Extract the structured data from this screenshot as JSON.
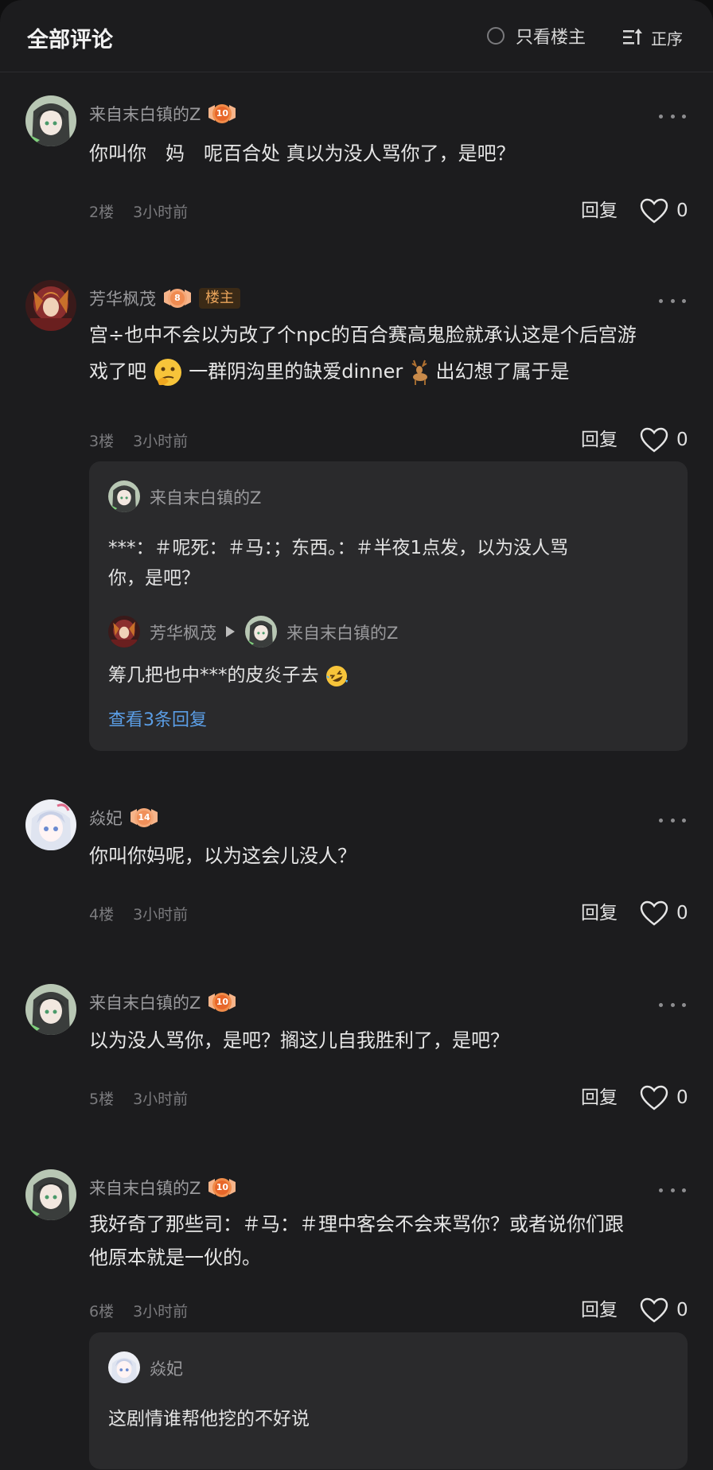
{
  "header": {
    "title": "全部评论",
    "only_op": "只看楼主",
    "sort": "正序"
  },
  "colors": {
    "background": "#1c1c1e",
    "reply_box": "#2a2a2c",
    "link": "#5b9ee6",
    "host_tag": "#e9a45b",
    "badge": "#f0a070"
  },
  "comments": [
    {
      "name": "来自末白镇的Z",
      "level": "10",
      "text": "你叫你　妈　呢百合处  真以为没人骂你了，是吧？",
      "floor": "2楼",
      "time": "3小时前",
      "reply": "回复",
      "likes": "0"
    },
    {
      "name": "芳华枫茂",
      "level": "8",
      "host_tag": "楼主",
      "text_line1": "宫÷也中不会以为改了个npc的百合赛高鬼脸就承认这是个后宫游",
      "text_line2a": "戏了吧",
      "emoji1": "thinking-face",
      "text_line2b": "一群阴沟里的缺爱dinner",
      "emoji2": "deer",
      "text_line2c": "出幻想了属于是",
      "floor": "3楼",
      "time": "3小时前",
      "reply": "回复",
      "likes": "0",
      "replies": {
        "r1_name": "来自末白镇的Z",
        "r1_text_line1": "***：＃呢死：＃马：；东西。：＃半夜1点发，以为没人骂",
        "r1_text_line2": "你，是吧？",
        "r2_from": "芳华枫茂",
        "r2_to": "来自末白镇的Z",
        "r2_text": "筹几把也中***的皮炎子去",
        "r2_emoji": "rolling-laughing-face",
        "view_more": "查看3条回复"
      }
    },
    {
      "name": "焱妃",
      "level": "14",
      "text": "你叫你妈呢，以为这会儿没人？",
      "floor": "4楼",
      "time": "3小时前",
      "reply": "回复",
      "likes": "0"
    },
    {
      "name": "来自末白镇的Z",
      "level": "10",
      "text": "以为没人骂你，是吧？搁这儿自我胜利了，是吧？",
      "floor": "5楼",
      "time": "3小时前",
      "reply": "回复",
      "likes": "0"
    },
    {
      "name": "来自末白镇的Z",
      "level": "10",
      "text_line1": "我好奇了那些司：＃马：＃理中客会不会来骂你？或者说你们跟",
      "text_line2": "他原本就是一伙的。",
      "floor": "6楼",
      "time": "3小时前",
      "reply": "回复",
      "likes": "0",
      "replies": {
        "r1_name": "焱妃",
        "r1_text": "这剧情谁帮他挖的不好说"
      }
    }
  ]
}
